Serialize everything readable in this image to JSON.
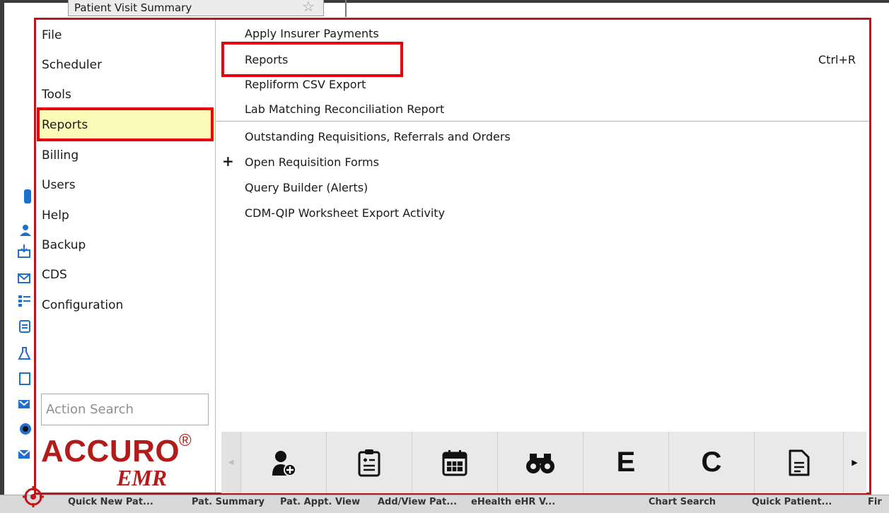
{
  "background": {
    "visit_tab_title": "Patient Visit Summary",
    "bottom_buttons": [
      "Quick New Pat...",
      "Pat. Summary",
      "Pat. Appt. View",
      "Add/View Pat...",
      "eHealth eHR V...",
      "Chart Search",
      "Quick Patient...",
      "Fir"
    ]
  },
  "menu": {
    "categories": [
      "File",
      "Scheduler",
      "Tools",
      "Reports",
      "Billing",
      "Users",
      "Help",
      "Backup",
      "CDS",
      "Configuration"
    ],
    "selected_category": "Reports",
    "items": [
      {
        "label": "Apply Insurer Payments",
        "shortcut": ""
      },
      {
        "label": "Reports",
        "shortcut": "Ctrl+R"
      },
      {
        "label": "Repliform CSV Export",
        "shortcut": ""
      },
      {
        "label": "Lab Matching Reconciliation Report",
        "shortcut": ""
      },
      {
        "label": "Outstanding Requisitions, Referrals and Orders",
        "shortcut": ""
      },
      {
        "label": "Open Requisition Forms",
        "shortcut": "",
        "expander": "+"
      },
      {
        "label": "Query Builder (Alerts)",
        "shortcut": ""
      },
      {
        "label": "CDM-QIP Worksheet Export Activity",
        "shortcut": ""
      }
    ],
    "action_search_placeholder": "Action Search",
    "logo": {
      "name": "ACCURO",
      "registered": "®",
      "sub": "EMR"
    },
    "toolbar_icons": [
      "add-patient-icon",
      "summary-clipboard-icon",
      "calendar-icon",
      "binoculars-icon",
      "letter-e-icon",
      "letter-c-icon",
      "document-icon"
    ],
    "toolbar_letters": {
      "e": "E",
      "c": "C"
    },
    "highlight_color": "#e8000f",
    "border_color": "#c0151b",
    "selected_bg": "#fbfab7"
  }
}
